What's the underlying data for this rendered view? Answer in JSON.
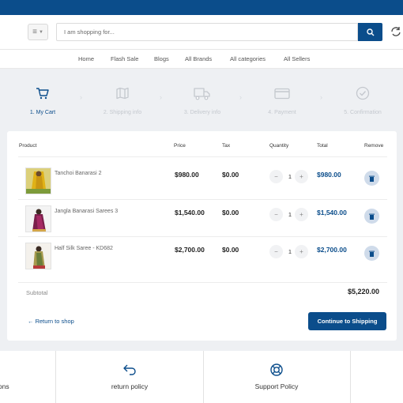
{
  "header": {
    "search_placeholder": "I am shopping for...",
    "icons": {
      "menu": "menu-icon",
      "search": "search-icon",
      "refresh": "refresh-icon"
    }
  },
  "nav": {
    "items": [
      "Home",
      "Flash Sale",
      "Blogs",
      "All Brands",
      "All categories",
      "All Sellers"
    ]
  },
  "steps": [
    {
      "label": "1. My Cart",
      "icon": "cart-icon",
      "active": true
    },
    {
      "label": "2. Shipping info",
      "icon": "map-icon",
      "active": false
    },
    {
      "label": "3. Delivery info",
      "icon": "truck-icon",
      "active": false
    },
    {
      "label": "4. Payment",
      "icon": "credit-card-icon",
      "active": false
    },
    {
      "label": "5. Confirmation",
      "icon": "check-circle-icon",
      "active": false
    }
  ],
  "cart": {
    "columns": {
      "product": "Product",
      "price": "Price",
      "tax": "Tax",
      "quantity": "Quantity",
      "total": "Total",
      "remove": "Remove"
    },
    "items": [
      {
        "name": "Tanchoi Banarasi 2",
        "price": "$980.00",
        "tax": "$0.00",
        "quantity": "1",
        "total": "$980.00"
      },
      {
        "name": "Jangla Banarasi Sarees 3",
        "price": "$1,540.00",
        "tax": "$0.00",
        "quantity": "1",
        "total": "$1,540.00"
      },
      {
        "name": "Half Silk Saree - KD682",
        "price": "$2,700.00",
        "tax": "$0.00",
        "quantity": "1",
        "total": "$2,700.00"
      }
    ],
    "qty_minus": "−",
    "qty_plus": "+",
    "subtotal_label": "Subtotal",
    "subtotal_value": "$5,220.00",
    "back_link": "← Return to shop",
    "continue_button": "Continue to Shipping"
  },
  "footer": {
    "left_partial": "ions",
    "items": [
      {
        "label": "return policy",
        "icon": "return-arrow-icon"
      },
      {
        "label": "Support Policy",
        "icon": "lifebuoy-icon"
      }
    ]
  },
  "colors": {
    "brand": "#0b4d8b",
    "background": "#eef0f3",
    "step_inactive": "#c4c8ce",
    "remove_bg": "#cfdbea"
  }
}
